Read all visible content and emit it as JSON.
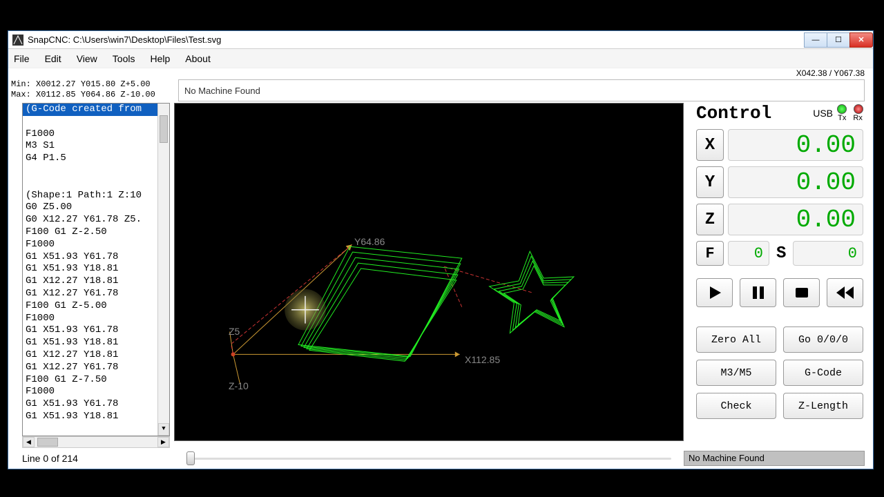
{
  "title": "SnapCNC: C:\\Users\\win7\\Desktop\\Files\\Test.svg",
  "menu": [
    "File",
    "Edit",
    "View",
    "Tools",
    "Help",
    "About"
  ],
  "cursor_status": "X042.38 / Y067.38",
  "bounds": "Min: X0012.27 Y015.80 Z+5.00\nMax: X0112.85 Y064.86 Z-10.00",
  "machine_top": "No Machine Found",
  "gcode": [
    "(G-Code created from",
    "",
    "F1000",
    "M3 S1",
    "G4 P1.5",
    "",
    "",
    "(Shape:1 Path:1 Z:10",
    "G0 Z5.00",
    "G0 X12.27 Y61.78 Z5.",
    "F100 G1 Z-2.50",
    "F1000",
    "G1 X51.93 Y61.78",
    "G1 X51.93 Y18.81",
    "G1 X12.27 Y18.81",
    "G1 X12.27 Y61.78",
    "F100 G1 Z-5.00",
    "F1000",
    "G1 X51.93 Y61.78",
    "G1 X51.93 Y18.81",
    "G1 X12.27 Y18.81",
    "G1 X12.27 Y61.78",
    "F100 G1 Z-7.50",
    "F1000",
    "G1 X51.93 Y61.78",
    "G1 X51.93 Y18.81"
  ],
  "viewport_labels": {
    "y": "Y64.86",
    "z": "Z5",
    "zneg": "Z-10",
    "x": "X112.85"
  },
  "control": {
    "title": "Control",
    "usb": "USB",
    "tx": "Tx",
    "rx": "Rx",
    "axes": {
      "X": "0.00",
      "Y": "0.00",
      "Z": "0.00"
    },
    "F": "0",
    "S": "0",
    "buttons": {
      "zero": "Zero All",
      "go": "Go 0/0/0",
      "m3": "M3/M5",
      "gcode": "G-Code",
      "check": "Check",
      "zlen": "Z-Length"
    }
  },
  "line_status": "Line 0 of 214",
  "machine_bottom": "No Machine Found"
}
